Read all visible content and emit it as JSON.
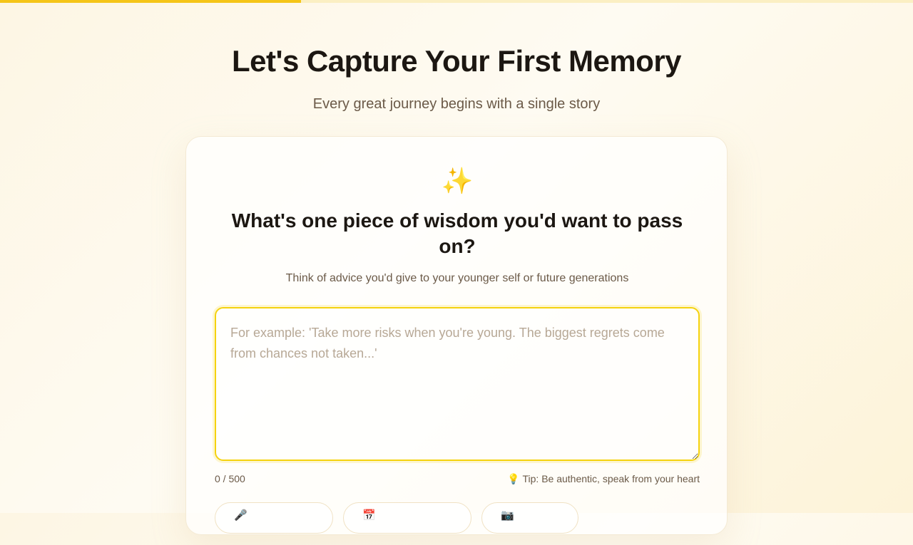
{
  "progress": {
    "value_percent": 33
  },
  "header": {
    "title": "Let's Capture Your First Memory",
    "subtitle": "Every great journey begins with a single story"
  },
  "card": {
    "icon": "sparkles-icon",
    "icon_glyph": "✨",
    "question": "What's one piece of wisdom you'd want to pass on?",
    "hint": "Think of advice you'd give to your younger self or future generations",
    "answer": {
      "value": "",
      "placeholder": "For example: 'Take more risks when you're young. The biggest regrets come from chances not taken...'"
    },
    "char_count": "0 / 500",
    "tip_glyph": "💡",
    "tip_text": "Tip: Be authentic, speak from your heart",
    "options": [
      {
        "icon": "microphone-icon",
        "glyph": "🎤"
      },
      {
        "icon": "calendar-icon",
        "glyph": "📅"
      },
      {
        "icon": "photo-icon",
        "glyph": "📷"
      }
    ]
  },
  "colors": {
    "accent": "#f5c518",
    "focus_border": "#f5d20f",
    "background": "#fdf6e4"
  }
}
